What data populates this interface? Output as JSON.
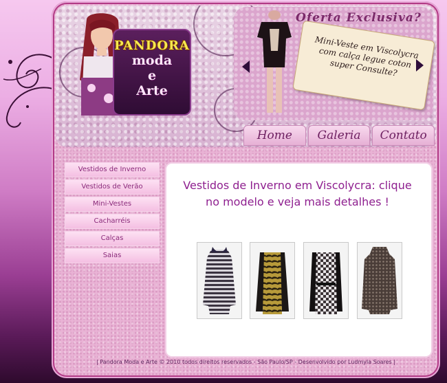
{
  "brand": {
    "logo_title": "PANDORA",
    "logo_line1": "moda",
    "logo_line2": "e",
    "logo_line3": "Arte"
  },
  "offer": {
    "title": "Oferta Exclusiva?",
    "tag_text": "Mini-Veste em Viscolycra com calça legue coton super Consulte?"
  },
  "nav": {
    "items": [
      {
        "label": "Home"
      },
      {
        "label": "Galeria"
      },
      {
        "label": "Contato"
      }
    ]
  },
  "sidebar": {
    "items": [
      {
        "label": "Vestidos de Inverno"
      },
      {
        "label": "Vestidos de Verão"
      },
      {
        "label": "Mini-Vestes"
      },
      {
        "label": "Cacharréis"
      },
      {
        "label": "Calças"
      },
      {
        "label": "Saias"
      }
    ]
  },
  "main": {
    "title": "Vestidos de Inverno em Viscolycra: clique no modelo e veja mais detalhes !"
  },
  "footer": {
    "text": "| Pandora Moda e Arte © 2010 todos direitos reservados - São Paulo/SP - Desenvolvido por Ludmyla Soares |"
  },
  "colors": {
    "accent": "#8e1f8f",
    "frame": "#b23a86",
    "background_dark": "#2e0a2d"
  }
}
